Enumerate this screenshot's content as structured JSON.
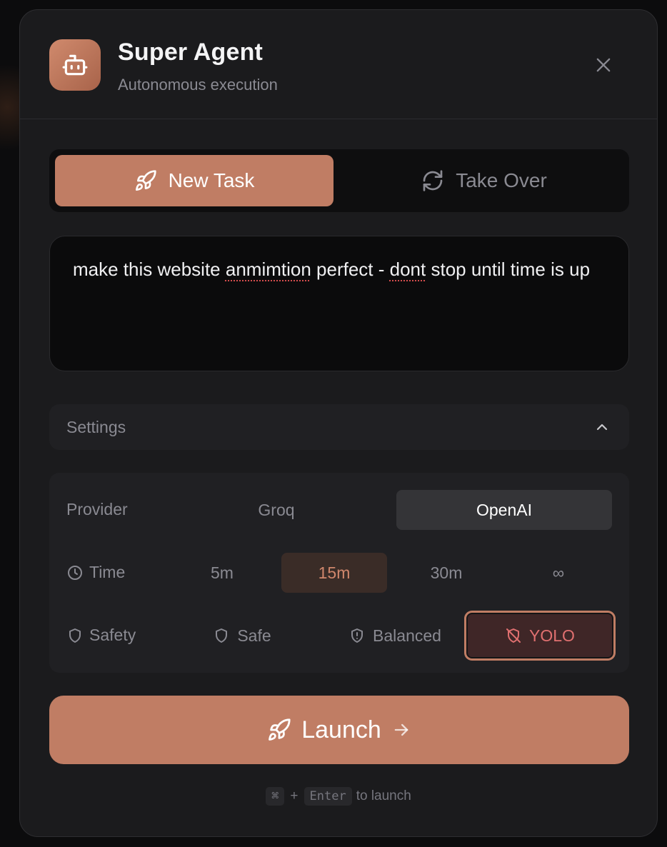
{
  "colors": {
    "accent": "#c07d64",
    "panel": "#1b1b1d",
    "yolo": "#e07070"
  },
  "header": {
    "title": "Super Agent",
    "subtitle": "Autonomous execution",
    "logo_icon": "robot-icon",
    "close_icon": "close-icon"
  },
  "tabs": [
    {
      "label": "New Task",
      "icon": "rocket-icon",
      "active": true
    },
    {
      "label": "Take Over",
      "icon": "refresh-icon",
      "active": false
    }
  ],
  "prompt": {
    "parts": [
      "make this website ",
      "anmimtion",
      " perfect - ",
      "dont",
      " stop until time is up"
    ]
  },
  "settings": {
    "label": "Settings",
    "expanded": true,
    "provider": {
      "label": "Provider",
      "options": [
        "Groq",
        "OpenAI"
      ],
      "selected": "OpenAI"
    },
    "time": {
      "label": "Time",
      "icon": "clock-icon",
      "options": [
        "5m",
        "15m",
        "30m",
        "∞"
      ],
      "selected": "15m"
    },
    "safety": {
      "label": "Safety",
      "icon": "shield-icon",
      "options": [
        "Safe",
        "Balanced",
        "YOLO"
      ],
      "selected": "YOLO"
    }
  },
  "launch": {
    "label": "Launch",
    "icon": "rocket-icon",
    "arrow_icon": "arrow-right-icon"
  },
  "hint": {
    "key1": "⌘",
    "plus": "+",
    "key2": "Enter",
    "text": "to launch"
  }
}
